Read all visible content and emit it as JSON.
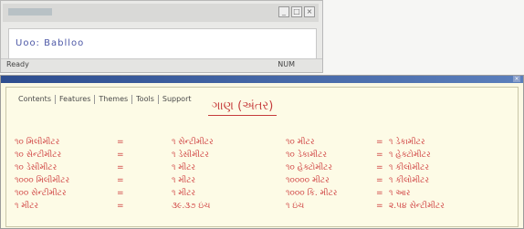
{
  "top_window": {
    "url_text": "Uoo: Bablloo",
    "status": {
      "left": "Ready",
      "right": "NUM"
    },
    "controls": [
      "_",
      "□",
      "×"
    ]
  },
  "main_window": {
    "tabs": [
      "Contents",
      "Features",
      "Themes",
      "Tools",
      "Support"
    ],
    "heading": "ગાણ (અંતર)",
    "rows": [
      [
        "૧૦ મિલીમીટર",
        "=",
        "૧ સેન્ટીમીટર",
        "૧૦ મીટર",
        "=",
        "૧ ડેકામીટર"
      ],
      [
        "૧૦ સેન્ટીમીટર",
        "=",
        "૧ ડેસીમીટર",
        "૧૦ ડેકામીટર",
        "=",
        "૧ હેક્ટોમીટર"
      ],
      [
        "૧૦ ડેસીમીટર",
        "=",
        "૧ મીટર",
        "૧૦ હેક્ટોમીટર",
        "=",
        "૧ કીલોમીટર"
      ],
      [
        "૧૦૦૦ મિલીમીટર",
        "=",
        "૧ મીટર",
        "૧૦૦૦૦ મીટર",
        "=",
        "૧ કીલોમીટર"
      ],
      [
        "૧૦૦ સેન્ટીમીટર",
        "=",
        "૧ મીટર",
        "૧૦૦૦ કિ. મીટર",
        "=",
        "૧ આર"
      ],
      [
        "૧ મીટર",
        "=",
        "૩૯.૩૭ ઇંચ",
        "૧ ઇંચ",
        "=",
        "૨.૫૪ સેન્ટીમીટર"
      ]
    ]
  }
}
